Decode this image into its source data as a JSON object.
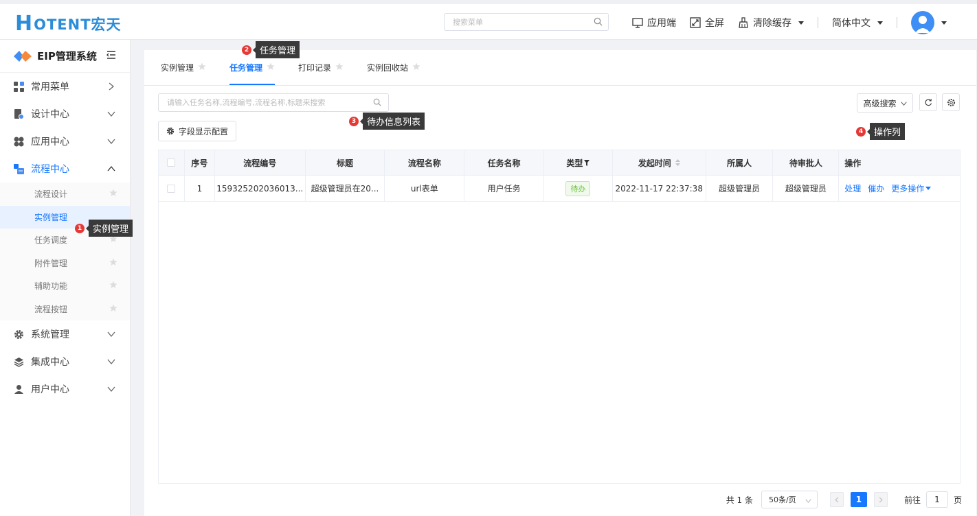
{
  "header": {
    "logo_h": "H",
    "logo_rest": "OTENT宏天",
    "search_placeholder": "搜索菜单",
    "app_end": "应用端",
    "fullscreen": "全屏",
    "clear_cache": "清除缓存",
    "language": "简体中文"
  },
  "sidebar": {
    "title": "EIP管理系统",
    "menus": [
      {
        "label": "常用菜单",
        "icon": "grid-apps-icon"
      },
      {
        "label": "设计中心",
        "icon": "design-doc-icon"
      },
      {
        "label": "应用中心",
        "icon": "app-center-icon"
      },
      {
        "label": "流程中心",
        "icon": "flow-center-icon"
      },
      {
        "label": "系统管理",
        "icon": "gear-icon"
      },
      {
        "label": "集成中心",
        "icon": "layers-icon"
      },
      {
        "label": "用户中心",
        "icon": "user-icon"
      }
    ],
    "submenu": [
      "流程设计",
      "实例管理",
      "任务调度",
      "附件管理",
      "辅助功能",
      "流程按钮"
    ]
  },
  "tabs": [
    "实例管理",
    "任务管理",
    "打印记录",
    "实例回收站"
  ],
  "toolbar": {
    "search_placeholder": "请输入任务名称,流程编号,流程名称,标题来搜索",
    "field_config": "字段显示配置",
    "advanced_search": "高级搜索"
  },
  "table": {
    "headers": [
      "序号",
      "流程编号",
      "标题",
      "流程名称",
      "任务名称",
      "类型",
      "发起时间",
      "所属人",
      "待审批人",
      "操作"
    ],
    "rows": [
      {
        "index": "1",
        "flow_no": "159325202036013...",
        "title": "超级管理员在20...",
        "flow_name": "url表单",
        "task_name": "用户任务",
        "type": "待办",
        "start_time": "2022-11-17 22:37:38",
        "owner": "超级管理员",
        "approver": "超级管理员",
        "actions": [
          "处理",
          "催办",
          "更多操作"
        ]
      }
    ]
  },
  "pagination": {
    "total": "共 1 条",
    "page_size": "50条/页",
    "current": "1",
    "goto_label": "前往",
    "goto_value": "1",
    "page_unit": "页"
  },
  "callouts": [
    {
      "num": "1",
      "text": "实例管理"
    },
    {
      "num": "2",
      "text": "任务管理"
    },
    {
      "num": "3",
      "text": "待办信息列表"
    },
    {
      "num": "4",
      "text": "操作列"
    }
  ],
  "colors": {
    "accent": "#1677ff",
    "logo": "#2b8cd8",
    "badge": "#e53935",
    "tag_green": "#67c23a"
  }
}
